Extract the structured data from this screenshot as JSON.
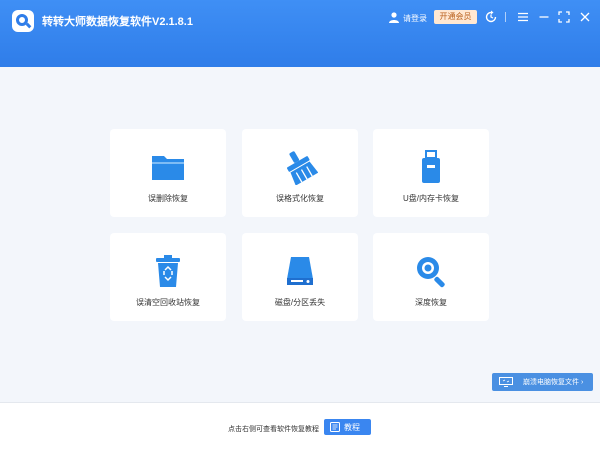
{
  "window": {
    "title": "转转大师数据恢复软件V2.1.8.1"
  },
  "header": {
    "login_label": "请登录",
    "vip_label": "开通会员",
    "icons": [
      "user-icon",
      "refresh-icon",
      "menu-icon",
      "minimize-icon",
      "maximize-icon",
      "close-icon"
    ]
  },
  "colors": {
    "brand": "#3586f0",
    "icon_blue": "#2a8ae8",
    "vip_bg": "#ffe8d2",
    "vip_text": "#b8601d"
  },
  "cards": [
    {
      "label": "误删除恢复",
      "icon": "folder-icon"
    },
    {
      "label": "误格式化恢复",
      "icon": "broom-icon"
    },
    {
      "label": "U盘/内存卡恢复",
      "icon": "usb-drive-icon"
    },
    {
      "label": "误清空回收站恢复",
      "icon": "recycle-bin-icon"
    },
    {
      "label": "磁盘/分区丢失",
      "icon": "disk-icon"
    },
    {
      "label": "深度恢复",
      "icon": "magnifier-icon"
    }
  ],
  "fast_restore": {
    "label": "崩溃电脑恢复文件 ›"
  },
  "footer": {
    "hint": "点击右侧可查看软件恢复教程",
    "tutorial_label": "教程"
  }
}
